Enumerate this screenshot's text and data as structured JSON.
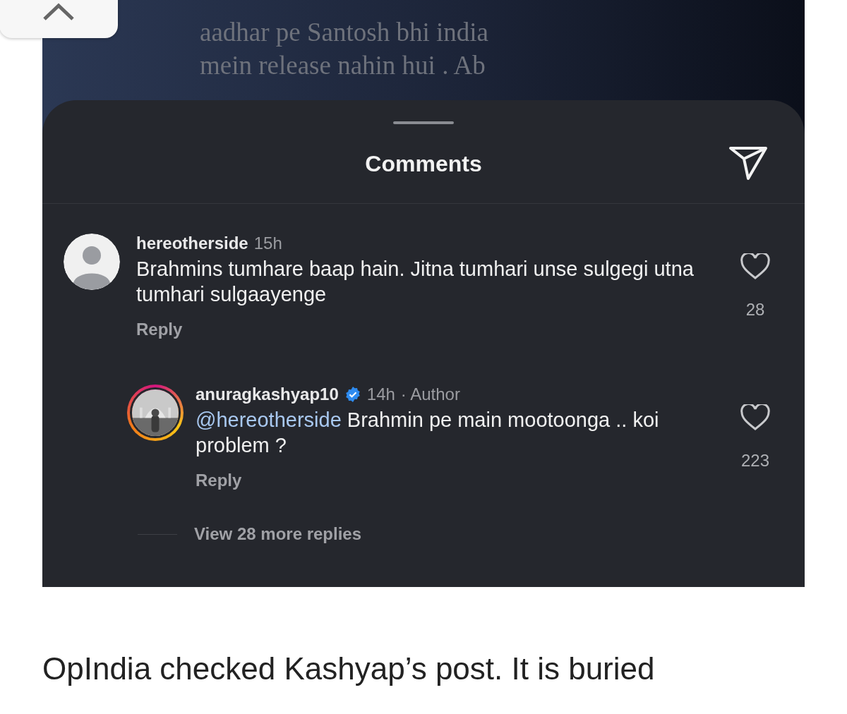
{
  "post_image": {
    "caption_lines": [
      "aadhar pe Santosh bhi india",
      "mein release nahin hui . Ab"
    ]
  },
  "comments_sheet": {
    "title": "Comments",
    "comments": [
      {
        "username": "hereotherside",
        "verified": false,
        "avatar": {
          "kind": "default"
        },
        "story_ring": false,
        "time": "15h",
        "text": "Brahmins tumhare baap hain. Jitna tumhari unse sulgegi utna tumhari sulgaayenge",
        "reply": "Reply",
        "likes": "28",
        "replies": [
          {
            "username": "anuragkashyap10",
            "verified": true,
            "story_ring": true,
            "time": "14h",
            "meta": "· Author",
            "mention": "@hereotherside",
            "text": "Brahmin pe main mootoonga .. koi problem ?",
            "reply": "Reply",
            "likes": "223"
          }
        ],
        "view_more": "View 28 more replies"
      }
    ]
  },
  "article": {
    "paragraph": "OpIndia checked Kashyap’s post. It is buried"
  }
}
